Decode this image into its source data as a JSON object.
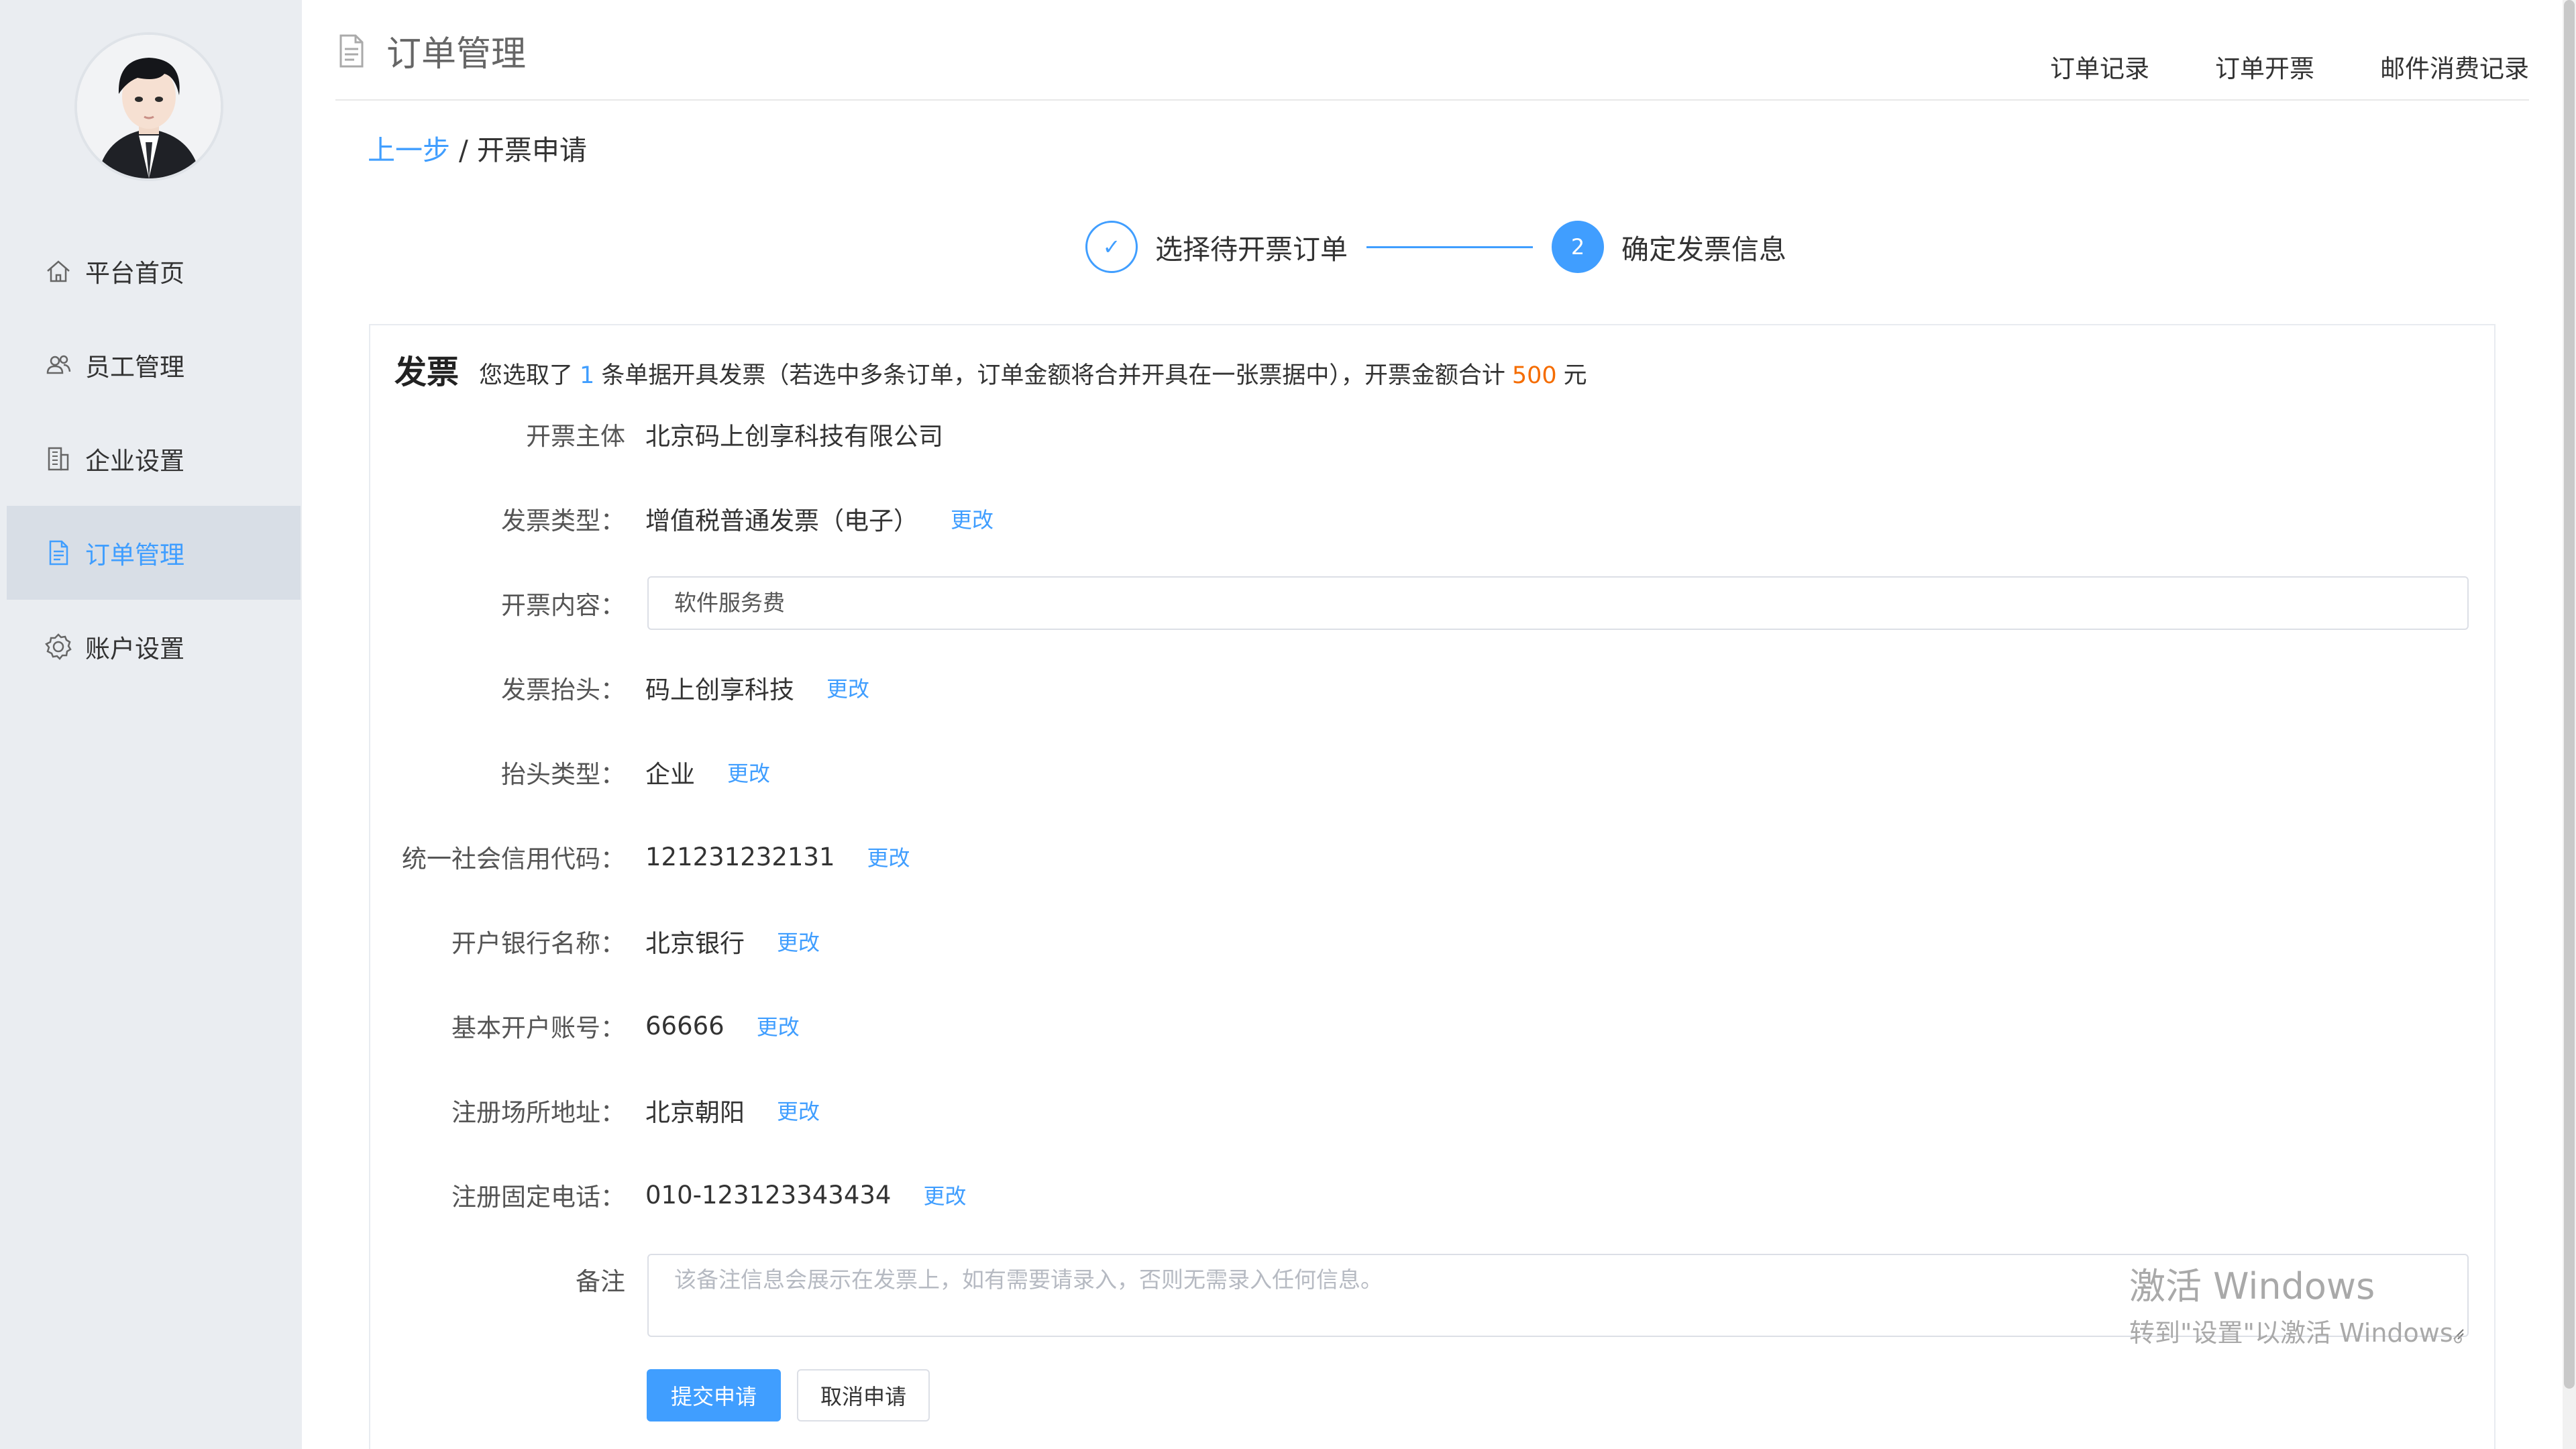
{
  "sidebar": {
    "avatar_alt": "user avatar",
    "items": [
      {
        "label": "平台首页",
        "icon": "home-icon"
      },
      {
        "label": "员工管理",
        "icon": "users-icon"
      },
      {
        "label": "企业设置",
        "icon": "building-icon"
      },
      {
        "label": "订单管理",
        "icon": "document-icon",
        "active": true
      },
      {
        "label": "账户设置",
        "icon": "gear-icon"
      }
    ]
  },
  "header": {
    "title": "订单管理",
    "links": [
      "订单记录",
      "订单开票",
      "邮件消费记录"
    ]
  },
  "breadcrumb": {
    "back": "上一步",
    "separator": " / ",
    "current": "开票申请"
  },
  "steps": [
    {
      "index": "✓",
      "label": "选择待开票订单",
      "status": "done"
    },
    {
      "index": "2",
      "label": "确定发票信息",
      "status": "active"
    }
  ],
  "invoice": {
    "title": "发票",
    "summary_pre": "您选取了",
    "count": "1",
    "summary_mid": "条单据开具发票（若选中多条订单，订单金额将合并开具在一张票据中），开票金额合计",
    "amount": "500",
    "unit": "元",
    "edit_label": "更改",
    "fields": {
      "issuer": {
        "label": "开票主体",
        "value": "北京码上创享科技有限公司"
      },
      "type": {
        "label": "发票类型：",
        "value": "增值税普通发票（电子）"
      },
      "content": {
        "label": "开票内容：",
        "value": "软件服务费"
      },
      "header": {
        "label": "发票抬头：",
        "value": "码上创享科技"
      },
      "header_type": {
        "label": "抬头类型：",
        "value": "企业"
      },
      "credit_code": {
        "label": "统一社会信用代码：",
        "value": "121231232131"
      },
      "bank": {
        "label": "开户银行名称：",
        "value": "北京银行"
      },
      "account": {
        "label": "基本开户账号：",
        "value": "66666"
      },
      "address": {
        "label": "注册场所地址：",
        "value": "北京朝阳"
      },
      "phone": {
        "label": "注册固定电话：",
        "value": "010-123123343434"
      },
      "remark": {
        "label": "备注",
        "placeholder": "该备注信息会展示在发票上，如有需要请录入，否则无需录入任何信息。"
      }
    },
    "submit": "提交申请",
    "cancel": "取消申请"
  },
  "watermark": {
    "line1": "激活 Windows",
    "line2": "转到\"设置\"以激活 Windows。"
  },
  "colors": {
    "accent": "#409eff",
    "amount": "#f56c00",
    "sidebar_bg": "#eaedf1"
  }
}
